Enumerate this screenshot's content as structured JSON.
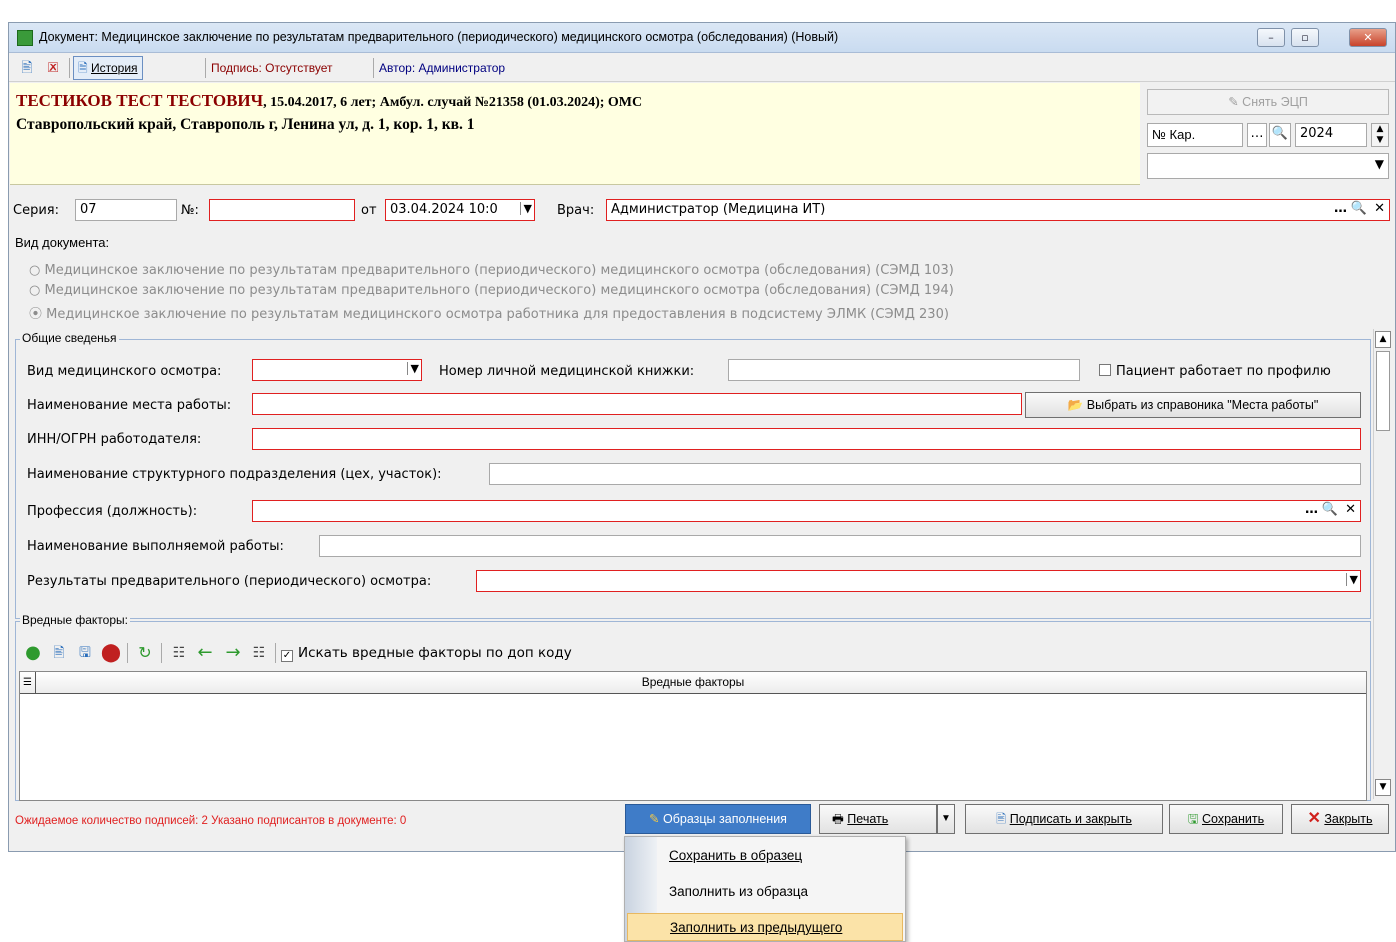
{
  "window": {
    "title": "Документ: Медицинское заключение по результатам предварительного (периодического) медицинского осмотра (обследования) (Новый)"
  },
  "toolbar": {
    "history_label": "История",
    "signature_label": "Подпись: Отсутствует",
    "author_label": "Автор: Администратор"
  },
  "patient": {
    "name": "ТЕСТИКОВ ТЕСТ ТЕСТОВИЧ",
    "details": ", 15.04.2017, 6 лет; Амбул. случай №21358 (01.03.2024); ОМС",
    "address": "Ставропольский край, Ставрополь г, Ленина ул, д. 1, кор. 1, кв. 1"
  },
  "right_panel": {
    "remove_ecp_label": "Снять ЭЦП",
    "card_no_label": "№ Кар.",
    "year": "2024"
  },
  "doc_header": {
    "series_label": "Серия:",
    "series_value": "07",
    "number_label": "№:",
    "number_value": "",
    "date_label": "от",
    "date_value": "03.04.2024 10:0",
    "doctor_label": "Врач:",
    "doctor_value": "Администратор (Медицина ИТ)"
  },
  "doc_type": {
    "label": "Вид документа:",
    "options": [
      "Медицинское заключение по результатам предварительного (периодического) медицинского осмотра (обследования) (СЭМД 103)",
      "Медицинское заключение по результатам предварительного (периодического) медицинского осмотра (обследования) (СЭМД 194)",
      "Медицинское заключение по результатам медицинского осмотра работника для предоставления в подсистему ЭЛМК (СЭМД 230)"
    ],
    "selected_index": 2
  },
  "general": {
    "group_title": "Общие сведенья",
    "exam_type_label": "Вид медицинского осмотра:",
    "exam_type_value": "",
    "med_book_label": "Номер личной медицинской книжки:",
    "med_book_value": "",
    "works_by_profile_label": "Пациент работает по профилю",
    "workplace_label": "Наименование места работы:",
    "workplace_value": "",
    "choose_workplace_label": "Выбрать из справоника \"Места работы\"",
    "inn_label": "ИНН/ОГРН работодателя:",
    "inn_value": "",
    "subdivision_label": "Наименование структурного подразделения (цех, участок):",
    "subdivision_value": "",
    "profession_label": "Профессия (должность):",
    "profession_value": "",
    "work_label": "Наименование выполняемой работы:",
    "work_value": "",
    "results_label": "Результаты предварительного (периодического) осмотра:",
    "results_value": ""
  },
  "hazards": {
    "group_title": "Вредные факторы:",
    "search_by_code_label": "Искать вредные факторы по доп коду",
    "column_header": "Вредные факторы"
  },
  "footer": {
    "status_text": "Ожидаемое количество подписей: 2 Указано подписантов в документе: 0",
    "templates_label": "Образцы заполнения",
    "print_label": "Печать",
    "sign_close_label": "Подписать и закрыть",
    "save_label": "Сохранить",
    "close_label": "Закрыть"
  },
  "templates_menu": {
    "items": [
      "Сохранить в образец",
      "Заполнить из образца",
      "Заполнить из предыдущего"
    ],
    "highlighted_index": 2
  },
  "colors": {
    "required_border": "#e02020",
    "header_bg": "#ffffe1",
    "status_red": "#e02020",
    "menu_highlight": "#fbe3a8"
  }
}
